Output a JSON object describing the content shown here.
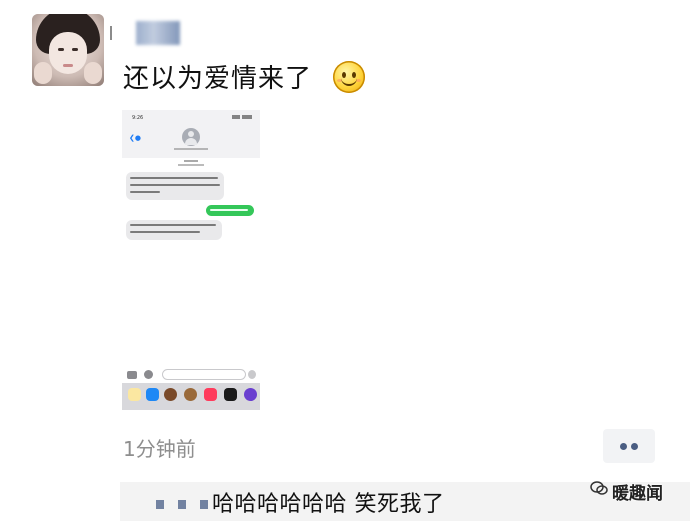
{
  "post": {
    "text": "还以为爱情来了",
    "emoji": "smiley-face-icon",
    "time": "1分钟前"
  },
  "comment": {
    "text": "哈哈哈哈哈哈  笑死我了"
  },
  "watermark": {
    "text": "暖趣闻"
  },
  "colors": {
    "name_link": "#5b6d92",
    "timestamp": "#8e8e8e",
    "imessage_blue": "#1f7cf5",
    "imessage_green": "#34c759",
    "comment_bg": "#f3f3f3"
  }
}
